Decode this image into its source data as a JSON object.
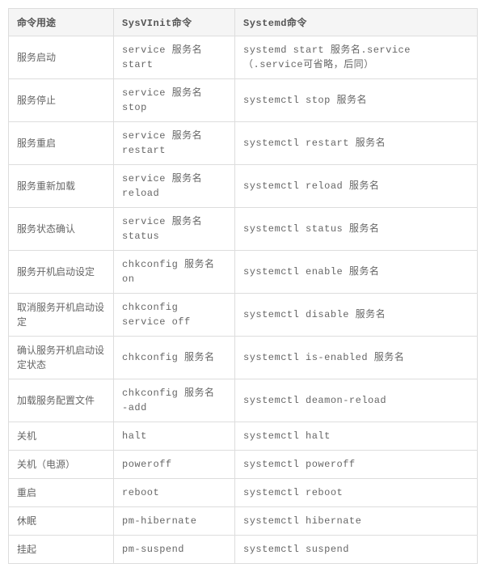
{
  "headers": {
    "usage": "命令用途",
    "sysvinit": "SysVInit命令",
    "systemd": "Systemd命令"
  },
  "rows": [
    {
      "usage": "服务启动",
      "sysvinit": "service 服务名 start",
      "systemd": "systemd start 服务名.service（.service可省略，后同）"
    },
    {
      "usage": "服务停止",
      "sysvinit": "service 服务名 stop",
      "systemd": "systemctl stop 服务名"
    },
    {
      "usage": "服务重启",
      "sysvinit": "service 服务名 restart",
      "systemd": "systemctl restart 服务名"
    },
    {
      "usage": "服务重新加载",
      "sysvinit": "service 服务名 reload",
      "systemd": "systemctl reload 服务名"
    },
    {
      "usage": "服务状态确认",
      "sysvinit": "service 服务名 status",
      "systemd": "systemctl status 服务名"
    },
    {
      "usage": "服务开机启动设定",
      "sysvinit": "chkconfig 服务名 on",
      "systemd": "systemctl enable 服务名"
    },
    {
      "usage": "取消服务开机启动设定",
      "sysvinit": "chkconfig service off",
      "systemd": "systemctl disable 服务名"
    },
    {
      "usage": "确认服务开机启动设定状态",
      "sysvinit": "chkconfig 服务名",
      "systemd": "systemctl is-enabled 服务名"
    },
    {
      "usage": "加载服务配置文件",
      "sysvinit": "chkconfig 服务名 -add",
      "systemd": "systemctl deamon-reload"
    },
    {
      "usage": "关机",
      "sysvinit": "halt",
      "systemd": "systemctl halt"
    },
    {
      "usage": "关机（电源）",
      "sysvinit": "poweroff",
      "systemd": "systemctl poweroff"
    },
    {
      "usage": "重启",
      "sysvinit": "reboot",
      "systemd": "systemctl reboot"
    },
    {
      "usage": "休眠",
      "sysvinit": "pm-hibernate",
      "systemd": "systemctl hibernate"
    },
    {
      "usage": "挂起",
      "sysvinit": "pm-suspend",
      "systemd": "systemctl suspend"
    }
  ]
}
